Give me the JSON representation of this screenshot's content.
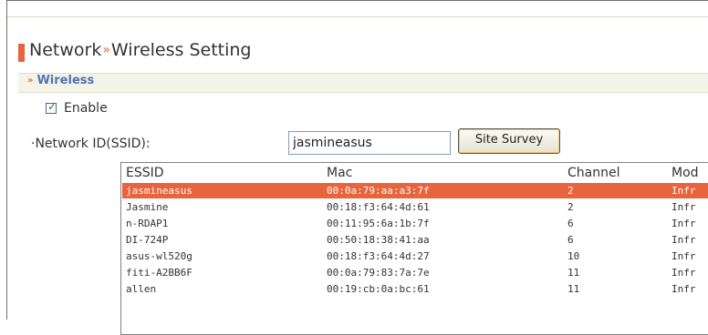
{
  "page": {
    "title_part1": "Network",
    "separator": "»",
    "title_part2": "Wireless Setting"
  },
  "section": {
    "arrow": "»",
    "title": "Wireless"
  },
  "enable": {
    "checked": true,
    "label": "Enable"
  },
  "ssid": {
    "label": "·Network ID(SSID):",
    "value": "jasmineasus"
  },
  "survey_button": "Site Survey",
  "site_list": {
    "columns": [
      "ESSID",
      "Mac",
      "Channel",
      "Mod"
    ],
    "rows": [
      {
        "essid": "jasmineasus",
        "mac": "00:0a:79:aa:a3:7f",
        "channel": "2",
        "mode": "Infr",
        "selected": true
      },
      {
        "essid": "Jasmine",
        "mac": "00:18:f3:64:4d:61",
        "channel": "2",
        "mode": "Infr"
      },
      {
        "essid": "n-RDAP1",
        "mac": "00:11:95:6a:1b:7f",
        "channel": "6",
        "mode": "Infr"
      },
      {
        "essid": "DI-724P",
        "mac": "00:50:18:38:41:aa",
        "channel": "6",
        "mode": "Infr"
      },
      {
        "essid": "asus-wl520g",
        "mac": "00:18:f3:64:4d:27",
        "channel": "10",
        "mode": "Infr"
      },
      {
        "essid": "fiti-A2BB6F",
        "mac": "00:0a:79:83:7a:7e",
        "channel": "11",
        "mode": "Infr"
      },
      {
        "essid": "allen",
        "mac": "00:19:cb:0a:bc:61",
        "channel": "11",
        "mode": "Infr"
      }
    ]
  },
  "colors": {
    "accent": "#e8643c",
    "section_text": "#5372b0"
  }
}
